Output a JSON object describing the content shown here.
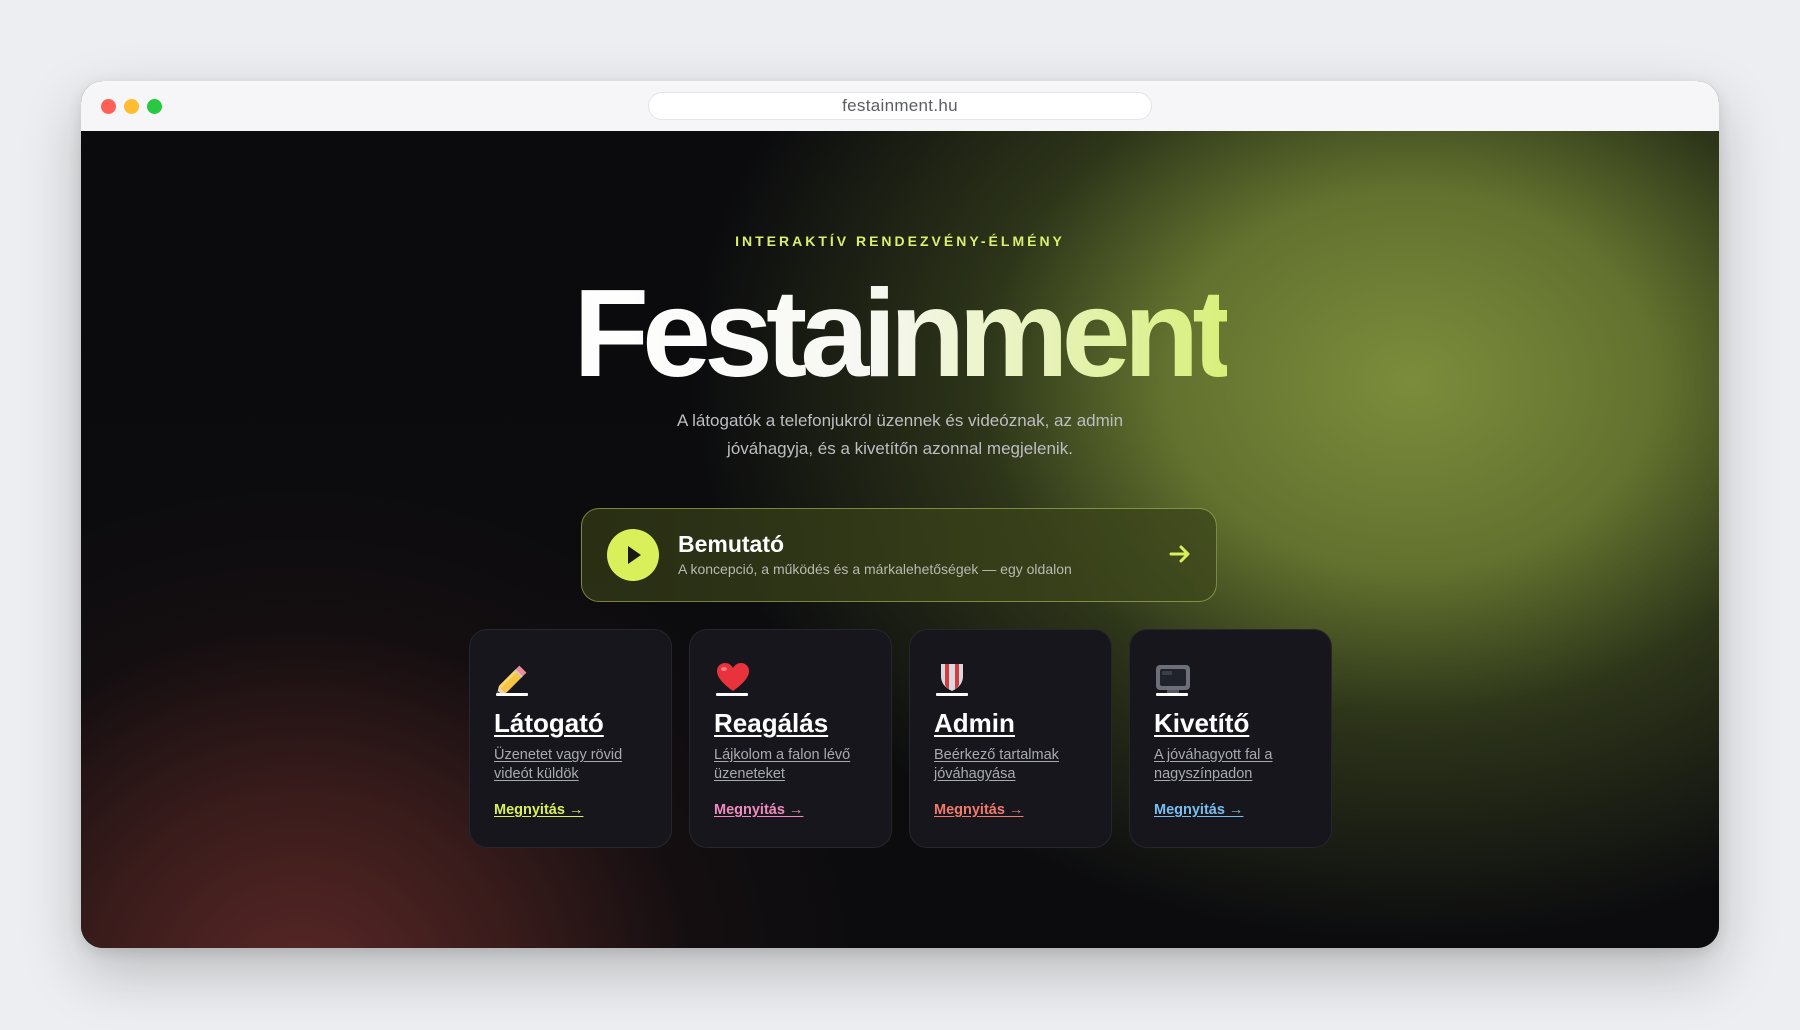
{
  "browser": {
    "url": "festainment.hu",
    "traffic_lights": [
      "#fe5f57",
      "#febc2e",
      "#28c840"
    ]
  },
  "hero": {
    "eyebrow": "INTERAKTÍV RENDEZVÉNY-ÉLMÉNY",
    "title": "Festainment",
    "subtitle": "A látogatók a telefonjukról üzennek és videóznak, az admin jóváhagyja, és a kivetítőn azonnal megjelenik."
  },
  "demo": {
    "title": "Bemutató",
    "subtitle": "A koncepció, a működés és a márkalehetőségek — egy oldalon",
    "icon": "play-icon",
    "arrow_icon": "arrow-right-icon",
    "accent": "#d9f05a"
  },
  "cards": [
    {
      "icon": "pencil-icon",
      "title": "Látogató",
      "description": "Üzenetet vagy rövid videót küldök",
      "link": "Megnyitás →",
      "link_color": "#d9f05a"
    },
    {
      "icon": "heart-icon",
      "title": "Reagálás",
      "description": "Lájkolom a falon lévő üzeneteket",
      "link": "Megnyitás →",
      "link_color": "#f08ac0"
    },
    {
      "icon": "shield-icon",
      "title": "Admin",
      "description": "Beérkező tartalmak jóváhagyása",
      "link": "Megnyitás →",
      "link_color": "#f27a6c"
    },
    {
      "icon": "tv-icon",
      "title": "Kivetítő",
      "description": "A jóváhagyott fal a nagyszínpadon",
      "link": "Megnyitás →",
      "link_color": "#78bff0"
    }
  ]
}
